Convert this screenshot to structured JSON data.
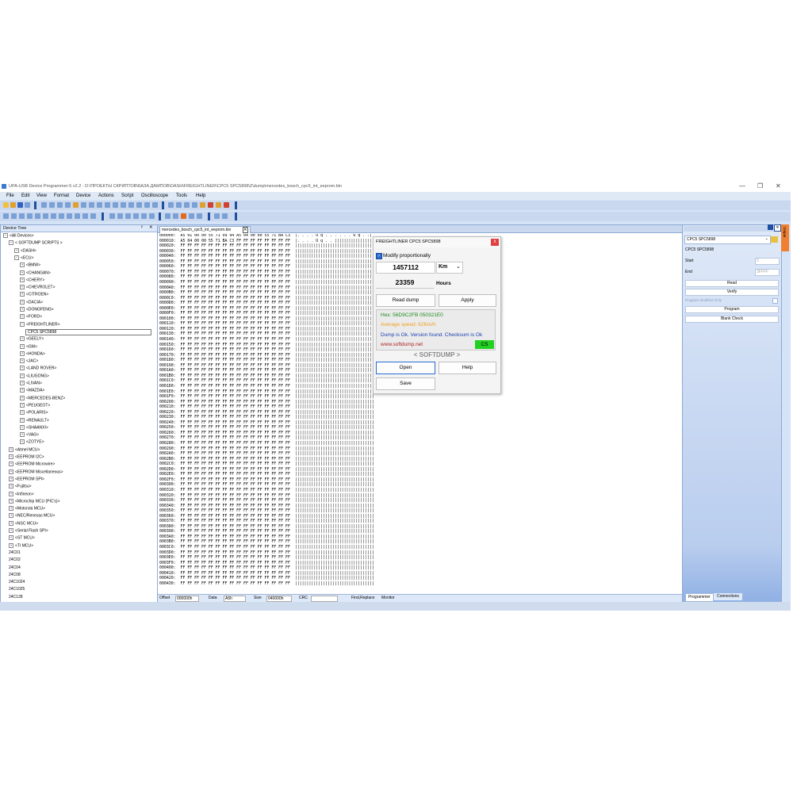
{
  "window": {
    "title": "UPA-USB Device Programmer-5 v2.2 - D:\\ПРОЕКТЫ СКРИПТОВ\\БАЗА ДАМПОВ\\DASH\\FREIGHTLINER\\CPC5 SPC5898\\Z\\dump\\mercedes_bosch_cpc5_int_eeprom.bin",
    "minimize": "—",
    "maximize": "❐",
    "close": "✕"
  },
  "menu": [
    "File",
    "Edit",
    "View",
    "Format",
    "Device",
    "Actions",
    "Script",
    "Oscilloscope",
    "Tools",
    "Help"
  ],
  "device_tree": {
    "header": "Device Tree",
    "pin": "ᵖ",
    "close": "✕",
    "nodes": [
      {
        "label": "<All Devices>",
        "level": 0,
        "expander": "−"
      },
      {
        "label": "< SOFTDUMP SCRIPTS >",
        "level": 1,
        "expander": "−"
      },
      {
        "label": "<DASH>",
        "level": 2,
        "expander": "+"
      },
      {
        "label": "<ECU>",
        "level": 2,
        "expander": "−"
      },
      {
        "label": "<BMW>",
        "level": 3,
        "expander": "+"
      },
      {
        "label": "<CHANGAN>",
        "level": 3,
        "expander": "+"
      },
      {
        "label": "<CHERY>",
        "level": 3,
        "expander": "+"
      },
      {
        "label": "<CHEVROLET>",
        "level": 3,
        "expander": "+"
      },
      {
        "label": "<CITROEN>",
        "level": 3,
        "expander": "+"
      },
      {
        "label": "<DACIA>",
        "level": 3,
        "expander": "+"
      },
      {
        "label": "<DONGFENG>",
        "level": 3,
        "expander": "+"
      },
      {
        "label": "<FORD>",
        "level": 3,
        "expander": "+"
      },
      {
        "label": "<FREIGHTLINER>",
        "level": 3,
        "expander": "−"
      },
      {
        "label": "CPC5 SPC5898",
        "level": 4,
        "expander": ""
      },
      {
        "label": "<GEELY>",
        "level": 3,
        "expander": "+"
      },
      {
        "label": "<GM>",
        "level": 3,
        "expander": "+"
      },
      {
        "label": "<HONDA>",
        "level": 3,
        "expander": "+"
      },
      {
        "label": "<JAC>",
        "level": 3,
        "expander": "+"
      },
      {
        "label": "<LAND ROVER>",
        "level": 3,
        "expander": "+"
      },
      {
        "label": "<LIUGONG>",
        "level": 3,
        "expander": "+"
      },
      {
        "label": "<LIVAN>",
        "level": 3,
        "expander": "+"
      },
      {
        "label": "<MAZDA>",
        "level": 3,
        "expander": "+"
      },
      {
        "label": "<MERCEDES-BENZ>",
        "level": 3,
        "expander": "+"
      },
      {
        "label": "<PEUGEOT>",
        "level": 3,
        "expander": "+"
      },
      {
        "label": "<POLARIS>",
        "level": 3,
        "expander": "+"
      },
      {
        "label": "<RENAULT>",
        "level": 3,
        "expander": "+"
      },
      {
        "label": "<SHAANXI>",
        "level": 3,
        "expander": "+"
      },
      {
        "label": "<VAG>",
        "level": 3,
        "expander": "+"
      },
      {
        "label": "<ZOTYE>",
        "level": 3,
        "expander": "+"
      },
      {
        "label": "<Atmel MCU>",
        "level": 1,
        "expander": "+"
      },
      {
        "label": "<EEPROM I2C>",
        "level": 1,
        "expander": "+"
      },
      {
        "label": "<EEPROM Microwire>",
        "level": 1,
        "expander": "+"
      },
      {
        "label": "<EEPROM Miscellaneous>",
        "level": 1,
        "expander": "+"
      },
      {
        "label": "<EEPROM SPI>",
        "level": 1,
        "expander": "+"
      },
      {
        "label": "<Fujitsu>",
        "level": 1,
        "expander": "+"
      },
      {
        "label": "<Infineon>",
        "level": 1,
        "expander": "+"
      },
      {
        "label": "<Microchip MCU (PIC's)>",
        "level": 1,
        "expander": "+"
      },
      {
        "label": "<Motorola MCU>",
        "level": 1,
        "expander": "+"
      },
      {
        "label": "<NEC/Renesas MCU>",
        "level": 1,
        "expander": "+"
      },
      {
        "label": "<NSC MCU>",
        "level": 1,
        "expander": "+"
      },
      {
        "label": "<Serial Flash SPI>",
        "level": 1,
        "expander": "+"
      },
      {
        "label": "<ST MCU>",
        "level": 1,
        "expander": "+"
      },
      {
        "label": "<TI MCU>",
        "level": 1,
        "expander": "+"
      },
      {
        "label": "24C01",
        "level": 1,
        "expander": ""
      },
      {
        "label": "24C02",
        "level": 1,
        "expander": ""
      },
      {
        "label": "24C04",
        "level": 1,
        "expander": ""
      },
      {
        "label": "24C08",
        "level": 1,
        "expander": ""
      },
      {
        "label": "24C1024",
        "level": 1,
        "expander": ""
      },
      {
        "label": "24C1025",
        "level": 1,
        "expander": ""
      },
      {
        "label": "24C128",
        "level": 1,
        "expander": ""
      }
    ]
  },
  "editor": {
    "tab_label": "mercedes_bosch_cpc5_int_eeprom.bin",
    "tab_close": "✕",
    "first_row": "000000:  A5 01 00 00 55 71 99 94 A5 04 00 00 55 71 BA C3  |. . . . U q . . . . . . U q . .|",
    "second_row": "000010:  A5 04 00 00 55 71 BA C3 FF FF FF FF FF FF FF FF  |. . . . U q . . |||||||||||||||||",
    "ff_bytes": "FF FF FF FF FF FF FF FF FF FF FF FF FF FF FF FF",
    "ff_ascii": "||||||||||||||||||||||||||||||||||",
    "row_count": 68
  },
  "status": {
    "offset_label": "Offset",
    "offset_value": "000000h",
    "data_label": "Data",
    "data_value": "A5h",
    "size_label": "Size",
    "size_value": "040000h",
    "crc_label": "CRC",
    "crc_value": "",
    "find_replace": "Find,Replace",
    "monitor": "Monitor"
  },
  "dialog": {
    "title": "FREIGHTLINER CPC5 SPC5898",
    "close": "x",
    "checkbox_label": "Modify proportionally",
    "checkbox_checked": true,
    "distance_value": "1457112",
    "unit_value": "Km",
    "unit_arrow": "⌄",
    "hours_value": "23359",
    "hours_label": "Hours",
    "read_dump": "Read dump",
    "apply": "Apply",
    "hex_info": "Hex: 56D9C2FB 050321E0",
    "avg_speed": "Average speed: 62Km/h",
    "status_msg": "Dump is Ok. Version found. Checksum is Ok",
    "website": "www.softdump.net",
    "cs_badge": "CS",
    "brand": "< SOFTDUMP >",
    "open": "Open",
    "help": "Help",
    "save": "Save",
    "colors": {
      "hex": "#1f8a1f",
      "avg": "#f0a020",
      "status": "#1a3fb0",
      "site": "#b02020",
      "cs": "#22d022"
    }
  },
  "programmer": {
    "device_select": "CPC5 SPC5898",
    "device_name": "CPC5 SPC5898",
    "start_label": "Start",
    "start_value": "0",
    "end_label": "End",
    "end_value": "3FFFF",
    "buttons": [
      "Read",
      "Verify"
    ],
    "program_modified_only": "Program Modified Only",
    "buttons2": [
      "Program",
      "Blank Check"
    ],
    "tabs": [
      "Programmer",
      "Connections"
    ],
    "side_tab": "Output"
  }
}
